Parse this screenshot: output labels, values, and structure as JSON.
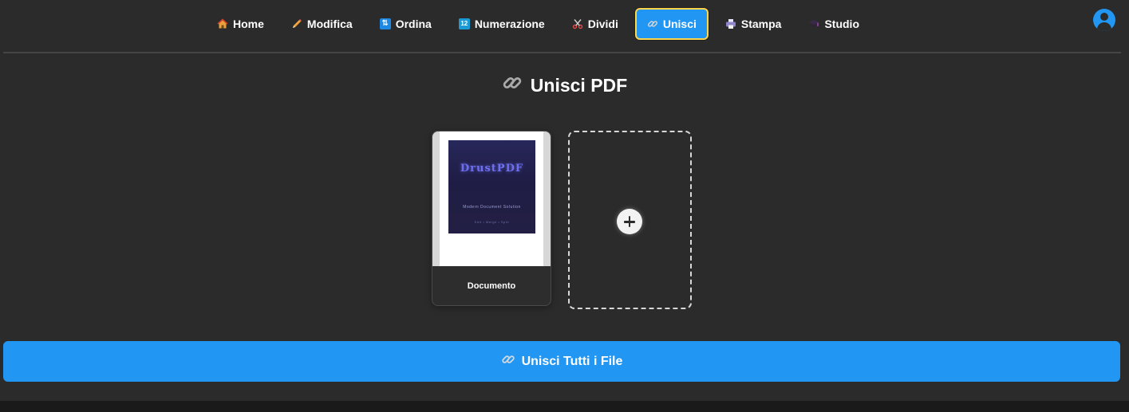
{
  "nav": {
    "items": [
      {
        "label": "Home",
        "icon": "house-icon"
      },
      {
        "label": "Modifica",
        "icon": "pencil-icon"
      },
      {
        "label": "Ordina",
        "icon": "reorder-icon"
      },
      {
        "label": "Numerazione",
        "icon": "numbers-icon"
      },
      {
        "label": "Dividi",
        "icon": "scissors-icon"
      },
      {
        "label": "Unisci",
        "icon": "link-icon",
        "active": true
      },
      {
        "label": "Stampa",
        "icon": "printer-icon"
      },
      {
        "label": "Studio",
        "icon": "graduation-cap-icon"
      }
    ],
    "account_icon": "account-circle-icon"
  },
  "page": {
    "title": "Unisci PDF",
    "title_icon": "link-icon"
  },
  "files": [
    {
      "label": "Documento",
      "cover_brand": "DrustPDF",
      "cover_tagline": "Modern Document Solution",
      "cover_sub": "Edit • Merge • Split"
    }
  ],
  "add_card": {
    "icon": "plus-icon"
  },
  "merge_button": {
    "label": "Unisci Tutti i File",
    "icon": "link-icon"
  },
  "colors": {
    "background": "#2b2b2b",
    "accent": "#2196f3",
    "active_border": "#ffd54a"
  }
}
